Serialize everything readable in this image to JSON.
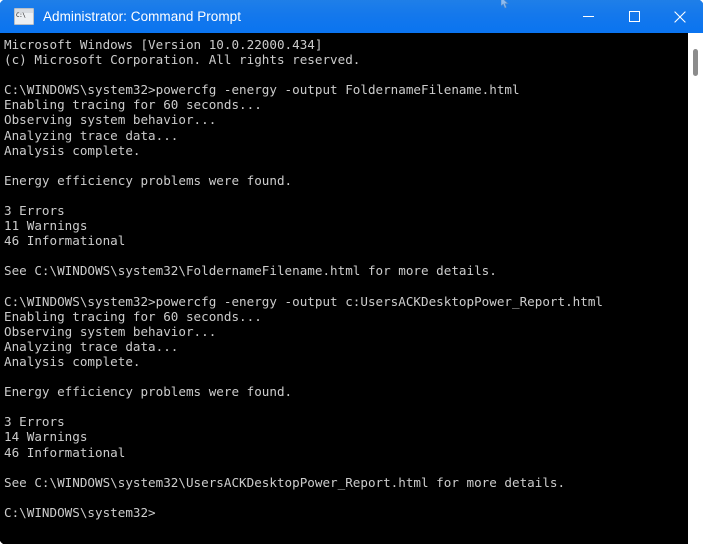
{
  "window": {
    "title": "Administrator: Command Prompt",
    "icon": "command-prompt-icon",
    "accent_color": "#0a74f0",
    "titlebar_text_color": "#ffffff",
    "console_background": "#000000",
    "console_text_color": "#cccccc",
    "controls": {
      "minimize_label": "Minimize",
      "maximize_label": "Maximize",
      "close_label": "Close"
    }
  },
  "scrollbar": {
    "thumb_position_percent": 3,
    "thumb_size_percent": 5
  },
  "console": {
    "prompt": "C:\\WINDOWS\\system32>",
    "text": "Microsoft Windows [Version 10.0.22000.434]\n(c) Microsoft Corporation. All rights reserved.\n\nC:\\WINDOWS\\system32>powercfg -energy -output FoldernameFilename.html\nEnabling tracing for 60 seconds...\nObserving system behavior...\nAnalyzing trace data...\nAnalysis complete.\n\nEnergy efficiency problems were found.\n\n3 Errors\n11 Warnings\n46 Informational\n\nSee C:\\WINDOWS\\system32\\FoldernameFilename.html for more details.\n\nC:\\WINDOWS\\system32>powercfg -energy -output c:UsersACKDesktopPower_Report.html\nEnabling tracing for 60 seconds...\nObserving system behavior...\nAnalyzing trace data...\nAnalysis complete.\n\nEnergy efficiency problems were found.\n\n3 Errors\n14 Warnings\n46 Informational\n\nSee C:\\WINDOWS\\system32\\UsersACKDesktopPower_Report.html for more details.\n\nC:\\WINDOWS\\system32>",
    "lines": [
      "Microsoft Windows [Version 10.0.22000.434]",
      "(c) Microsoft Corporation. All rights reserved.",
      "",
      "C:\\WINDOWS\\system32>powercfg -energy -output FoldernameFilename.html",
      "Enabling tracing for 60 seconds...",
      "Observing system behavior...",
      "Analyzing trace data...",
      "Analysis complete.",
      "",
      "Energy efficiency problems were found.",
      "",
      "3 Errors",
      "11 Warnings",
      "46 Informational",
      "",
      "See C:\\WINDOWS\\system32\\FoldernameFilename.html for more details.",
      "",
      "C:\\WINDOWS\\system32>powercfg -energy -output c:UsersACKDesktopPower_Report.html",
      "Enabling tracing for 60 seconds...",
      "Observing system behavior...",
      "Analyzing trace data...",
      "Analysis complete.",
      "",
      "Energy efficiency problems were found.",
      "",
      "3 Errors",
      "14 Warnings",
      "46 Informational",
      "",
      "See C:\\WINDOWS\\system32\\UsersACKDesktopPower_Report.html for more details.",
      "",
      "C:\\WINDOWS\\system32>"
    ],
    "runs": [
      {
        "command": "powercfg -energy -output FoldernameFilename.html",
        "errors": "3 Errors",
        "warnings": "11 Warnings",
        "informational": "46 Informational",
        "report_path": "C:\\WINDOWS\\system32\\FoldernameFilename.html",
        "result": "Energy efficiency problems were found."
      },
      {
        "command": "powercfg -energy -output c:UsersACKDesktopPower_Report.html",
        "errors": "3 Errors",
        "warnings": "14 Warnings",
        "informational": "46 Informational",
        "report_path": "C:\\WINDOWS\\system32\\UsersACKDesktopPower_Report.html",
        "result": "Energy efficiency problems were found."
      }
    ]
  }
}
